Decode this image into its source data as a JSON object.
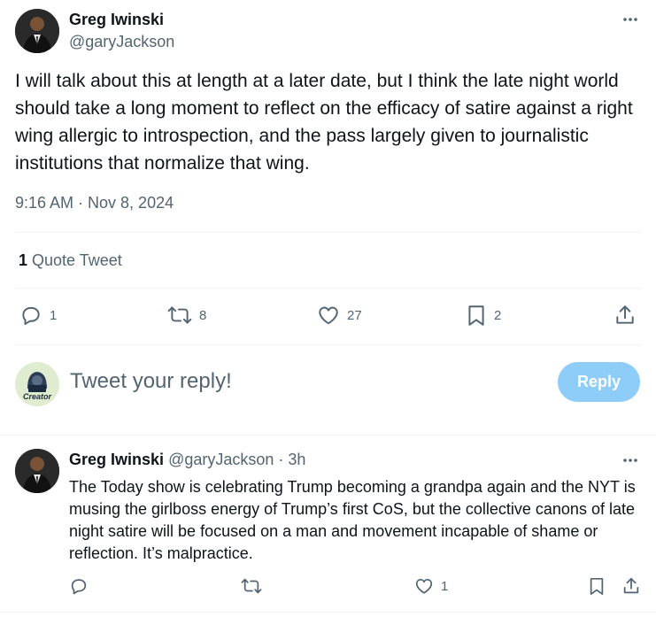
{
  "tweet": {
    "author_name": "Greg Iwinski",
    "author_handle": "@garyJackson",
    "text": "I will talk about this at length at a later date, but I think the late night world should take a long moment to reflect on the efficacy of satire against a right wing allergic to introspection, and the pass largely given to journalistic institutions that normalize that wing.",
    "timestamp": "9:16 AM · Nov 8, 2024",
    "quote_count": "1",
    "quote_label": "Quote Tweet",
    "actions": {
      "reply_count": "1",
      "retweet_count": "8",
      "like_count": "27",
      "bookmark_count": "2"
    }
  },
  "composer": {
    "placeholder": "Tweet your reply!",
    "reply_button": "Reply",
    "avatar_label": "Creator"
  },
  "reply": {
    "author_name": "Greg Iwinski",
    "author_handle": "@garyJackson",
    "time": "· 3h",
    "text": "The Today show is celebrating Trump becoming a grandpa again and the NYT is musing the girlboss energy of Trump’s first CoS, but the collective canons of late night satire will be focused on a man and movement incapable of shame or reflection. It’s malpractice.",
    "actions": {
      "like_count": "1"
    }
  },
  "colors": {
    "text": "#0f1419",
    "muted": "#536471",
    "reply_button": "#8ecdf8",
    "divider": "#eff3f4"
  }
}
